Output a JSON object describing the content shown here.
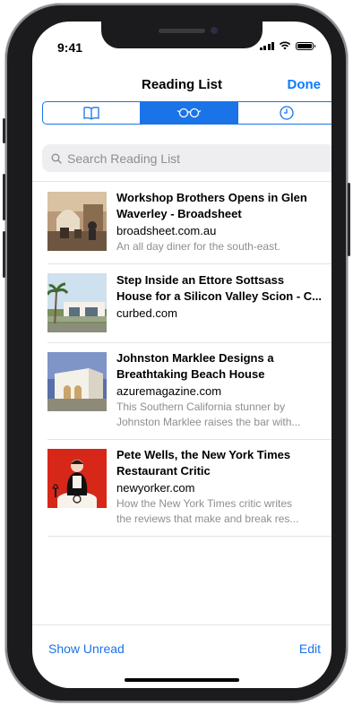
{
  "status": {
    "time": "9:41"
  },
  "nav": {
    "title": "Reading List",
    "done_label": "Done"
  },
  "segments": [
    {
      "icon": "bookmarks-icon",
      "selected": false
    },
    {
      "icon": "reading-list-glasses-icon",
      "selected": true
    },
    {
      "icon": "history-clock-icon",
      "selected": false
    }
  ],
  "search": {
    "placeholder": "Search Reading List"
  },
  "items": [
    {
      "title_line1": "Workshop Brothers Opens in Glen",
      "title_line2": "Waverley - Broadsheet",
      "domain": "broadsheet.com.au",
      "desc_line1": "An all day diner for the south-east.",
      "desc_line2": ""
    },
    {
      "title_line1": "Step Inside an Ettore Sottsass",
      "title_line2": "House for a Silicon Valley Scion - C...",
      "domain": "curbed.com",
      "desc_line1": "",
      "desc_line2": ""
    },
    {
      "title_line1": "Johnston Marklee Designs a",
      "title_line2": "Breathtaking Beach House",
      "domain": "azuremagazine.com",
      "desc_line1": "This Southern California stunner by",
      "desc_line2": "Johnston Marklee raises the bar with..."
    },
    {
      "title_line1": "Pete Wells, the New York Times",
      "title_line2": "Restaurant Critic",
      "domain": "newyorker.com",
      "desc_line1": "How the New York Times critic writes",
      "desc_line2": "the reviews that make and break res..."
    }
  ],
  "toolbar": {
    "show_unread_label": "Show Unread",
    "edit_label": "Edit"
  },
  "colors": {
    "accent": "#1b73e8",
    "secondary_text": "#8e8e93"
  }
}
